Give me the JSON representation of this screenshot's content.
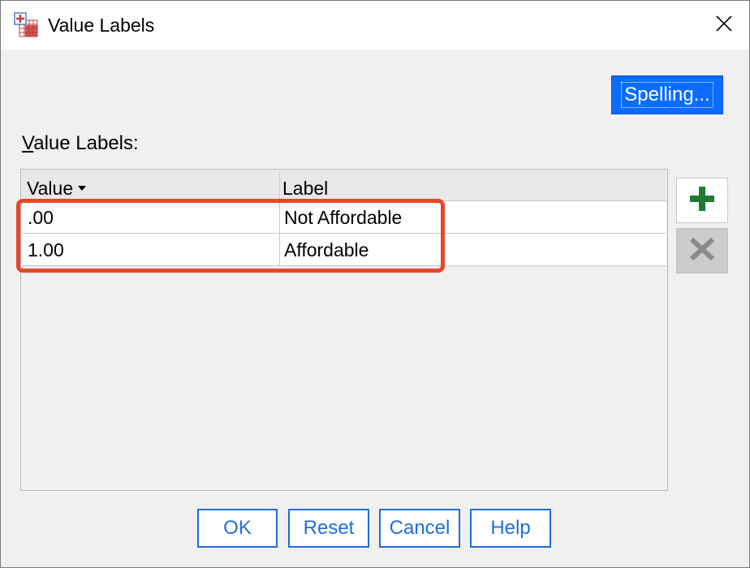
{
  "window": {
    "title": "Value Labels",
    "close_icon": "close-icon"
  },
  "toolbar": {
    "spelling_label": "Spelling..."
  },
  "section": {
    "label_prefix": "V",
    "label_rest": "alue Labels:"
  },
  "grid": {
    "columns": [
      "Value",
      "Label"
    ],
    "sort_icon": "sort-down-icon",
    "rows": [
      {
        "value": ".00",
        "label": "Not Affordable"
      },
      {
        "value": "1.00",
        "label": "Affordable"
      }
    ]
  },
  "side_buttons": {
    "add_icon": "plus-icon",
    "remove_icon": "x-icon"
  },
  "buttons": {
    "ok": "OK",
    "reset": "Reset",
    "cancel": "Cancel",
    "help": "Help"
  },
  "colors": {
    "accent_blue": "#0b6cff",
    "button_border": "#1f6fd6",
    "highlight": "#e8462a",
    "add_green": "#1e7b34"
  }
}
